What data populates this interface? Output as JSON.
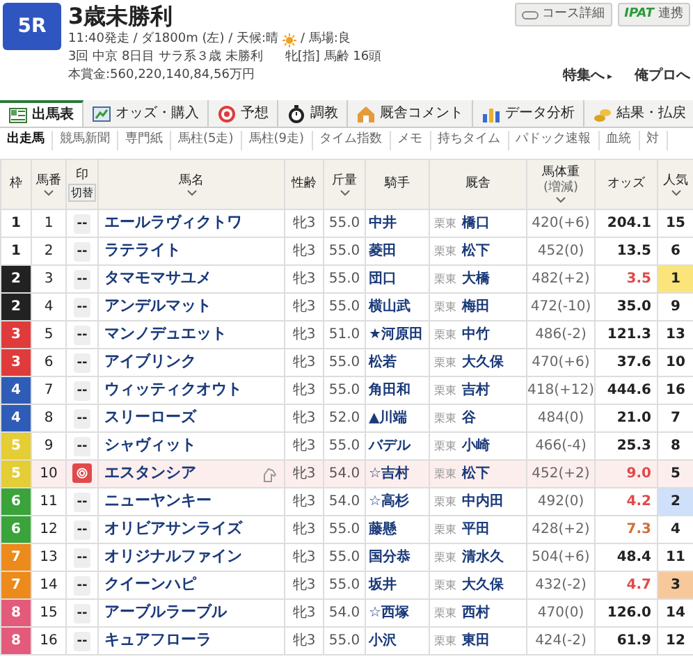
{
  "race": {
    "number": "5R",
    "title": "3歳未勝利",
    "info_before_icon": "11:40発走 / ダ1800m (左) / 天候:晴",
    "info_after_icon": "/ 馬場:良",
    "meta": "3回 中京 8日目 サラ系３歳 未勝利",
    "conditions": "牝[指] 馬齢 16頭",
    "prize": "本賞金:560,220,140,84,56万円"
  },
  "header_buttons": [
    {
      "label": "コース詳細",
      "kind": "course"
    },
    {
      "label": "連携",
      "kind": "ipat",
      "logo": "IPAT"
    }
  ],
  "links": [
    {
      "label": "特集へ",
      "arrow": "▸"
    },
    {
      "label": "俺プロへ"
    }
  ],
  "tabs": [
    {
      "label": "出馬表",
      "selected": true
    },
    {
      "label": "オッズ・購入",
      "selected": false
    },
    {
      "label": "予想",
      "selected": false
    },
    {
      "label": "調教",
      "selected": false
    },
    {
      "label": "厩舎コメント",
      "selected": false
    },
    {
      "label": "データ分析",
      "selected": false
    },
    {
      "label": "結果・払戻",
      "selected": false
    }
  ],
  "subtabs": [
    {
      "label": "出走馬",
      "selected": true
    },
    {
      "label": "競馬新聞",
      "selected": false
    },
    {
      "label": "専門紙",
      "selected": false
    },
    {
      "label": "馬柱(5走)",
      "selected": false
    },
    {
      "label": "馬柱(9走)",
      "selected": false
    },
    {
      "label": "タイム指数",
      "selected": false
    },
    {
      "label": "メモ",
      "selected": false
    },
    {
      "label": "持ちタイム",
      "selected": false
    },
    {
      "label": "パドック速報",
      "selected": false
    },
    {
      "label": "血統",
      "selected": false
    },
    {
      "label": "対",
      "selected": false
    }
  ],
  "table": {
    "columns": [
      {
        "label": "枠",
        "sortable": false
      },
      {
        "label": "馬番",
        "sortable": true
      },
      {
        "label": "印",
        "sortable": false,
        "button": "切替"
      },
      {
        "label": "馬名",
        "sortable": true
      },
      {
        "label": "性齢",
        "sortable": false
      },
      {
        "label": "斤量",
        "sortable": true
      },
      {
        "label": "騎手",
        "sortable": false
      },
      {
        "label": "厩舎",
        "sortable": false
      },
      {
        "label": "馬体重",
        "sublabel": "(増減)",
        "sortable": true
      },
      {
        "label": "オッズ",
        "sortable": false
      },
      {
        "label": "人気",
        "sortable": true
      }
    ],
    "rows": [
      {
        "frame": {
          "label": "1",
          "color": "#ffffff"
        },
        "number": "1",
        "mark": {
          "kind": "none",
          "label": "--"
        },
        "name": "エールラヴィクトワ",
        "icon": false,
        "selected": false,
        "sex_age": "牝3",
        "weight": "55.0",
        "jockey": "中井",
        "region": "栗東",
        "trainer": "橋口",
        "body_weight": "420(+6)",
        "odds": {
          "value": "204.1"
        },
        "popularity": {
          "value": "15"
        }
      },
      {
        "frame": {
          "label": "1",
          "color": "#ffffff"
        },
        "number": "2",
        "mark": {
          "kind": "none",
          "label": "--"
        },
        "name": "ラテライト",
        "icon": false,
        "selected": false,
        "sex_age": "牝3",
        "weight": "55.0",
        "jockey": "菱田",
        "region": "栗東",
        "trainer": "松下",
        "body_weight": "452(0)",
        "odds": {
          "value": "13.5"
        },
        "popularity": {
          "value": "6"
        }
      },
      {
        "frame": {
          "label": "2",
          "color": "#222222"
        },
        "number": "3",
        "mark": {
          "kind": "none",
          "label": "--"
        },
        "name": "タマモマサユメ",
        "icon": false,
        "selected": false,
        "sex_age": "牝3",
        "weight": "55.0",
        "jockey": "団口",
        "region": "栗東",
        "trainer": "大橋",
        "body_weight": "482(+2)",
        "odds": {
          "value": "3.5",
          "color": "#e04a4a"
        },
        "popularity": {
          "value": "1",
          "color": "#fbe57a"
        }
      },
      {
        "frame": {
          "label": "2",
          "color": "#222222"
        },
        "number": "4",
        "mark": {
          "kind": "none",
          "label": "--"
        },
        "name": "アンデルマット",
        "icon": false,
        "selected": false,
        "sex_age": "牝3",
        "weight": "55.0",
        "jockey": "横山武",
        "region": "栗東",
        "trainer": "梅田",
        "body_weight": "472(-10)",
        "odds": {
          "value": "35.0"
        },
        "popularity": {
          "value": "9"
        }
      },
      {
        "frame": {
          "label": "3",
          "color": "#e03b3b"
        },
        "number": "5",
        "mark": {
          "kind": "none",
          "label": "--"
        },
        "name": "マンノデュエット",
        "icon": false,
        "selected": false,
        "sex_age": "牝3",
        "weight": "51.0",
        "jockey": "★河原田",
        "region": "栗東",
        "trainer": "中竹",
        "body_weight": "486(-2)",
        "odds": {
          "value": "121.3"
        },
        "popularity": {
          "value": "13"
        }
      },
      {
        "frame": {
          "label": "3",
          "color": "#e03b3b"
        },
        "number": "6",
        "mark": {
          "kind": "none",
          "label": "--"
        },
        "name": "アイブリンク",
        "icon": false,
        "selected": false,
        "sex_age": "牝3",
        "weight": "55.0",
        "jockey": "松若",
        "region": "栗東",
        "trainer": "大久保",
        "body_weight": "470(+6)",
        "odds": {
          "value": "37.6"
        },
        "popularity": {
          "value": "10"
        }
      },
      {
        "frame": {
          "label": "4",
          "color": "#2f5cb6"
        },
        "number": "7",
        "mark": {
          "kind": "none",
          "label": "--"
        },
        "name": "ウィッティクオウト",
        "icon": false,
        "selected": false,
        "sex_age": "牝3",
        "weight": "55.0",
        "jockey": "角田和",
        "region": "栗東",
        "trainer": "吉村",
        "body_weight": "418(+12)",
        "odds": {
          "value": "444.6"
        },
        "popularity": {
          "value": "16"
        }
      },
      {
        "frame": {
          "label": "4",
          "color": "#2f5cb6"
        },
        "number": "8",
        "mark": {
          "kind": "none",
          "label": "--"
        },
        "name": "スリーローズ",
        "icon": false,
        "selected": false,
        "sex_age": "牝3",
        "weight": "52.0",
        "jockey": "▲川端",
        "region": "栗東",
        "trainer": "谷",
        "body_weight": "484(0)",
        "odds": {
          "value": "21.0"
        },
        "popularity": {
          "value": "7"
        }
      },
      {
        "frame": {
          "label": "5",
          "color": "#e5cd35"
        },
        "number": "9",
        "mark": {
          "kind": "none",
          "label": "--"
        },
        "name": "シャヴィット",
        "icon": false,
        "selected": false,
        "sex_age": "牝3",
        "weight": "55.0",
        "jockey": "バデル",
        "region": "栗東",
        "trainer": "小崎",
        "body_weight": "466(-4)",
        "odds": {
          "value": "25.3"
        },
        "popularity": {
          "value": "8"
        }
      },
      {
        "frame": {
          "label": "5",
          "color": "#e5cd35"
        },
        "number": "10",
        "mark": {
          "kind": "circle"
        },
        "name": "エスタンシア",
        "icon": true,
        "selected": true,
        "sex_age": "牝3",
        "weight": "54.0",
        "jockey": "☆吉村",
        "region": "栗東",
        "trainer": "松下",
        "body_weight": "452(+2)",
        "odds": {
          "value": "9.0",
          "color": "#e04a4a"
        },
        "popularity": {
          "value": "5"
        }
      },
      {
        "frame": {
          "label": "6",
          "color": "#3aa33a"
        },
        "number": "11",
        "mark": {
          "kind": "none",
          "label": "--"
        },
        "name": "ニューヤンキー",
        "icon": false,
        "selected": false,
        "sex_age": "牝3",
        "weight": "54.0",
        "jockey": "☆高杉",
        "region": "栗東",
        "trainer": "中内田",
        "body_weight": "492(0)",
        "odds": {
          "value": "4.2",
          "color": "#e04a4a"
        },
        "popularity": {
          "value": "2",
          "color": "#cfe0fa"
        }
      },
      {
        "frame": {
          "label": "6",
          "color": "#3aa33a"
        },
        "number": "12",
        "mark": {
          "kind": "none",
          "label": "--"
        },
        "name": "オリビアサンライズ",
        "icon": false,
        "selected": false,
        "sex_age": "牝3",
        "weight": "55.0",
        "jockey": "藤懸",
        "region": "栗東",
        "trainer": "平田",
        "body_weight": "428(+2)",
        "odds": {
          "value": "7.3",
          "color": "#d0703a"
        },
        "popularity": {
          "value": "4"
        }
      },
      {
        "frame": {
          "label": "7",
          "color": "#ec8a1c"
        },
        "number": "13",
        "mark": {
          "kind": "none",
          "label": "--"
        },
        "name": "オリジナルファイン",
        "icon": false,
        "selected": false,
        "sex_age": "牝3",
        "weight": "55.0",
        "jockey": "国分恭",
        "region": "栗東",
        "trainer": "清水久",
        "body_weight": "504(+6)",
        "odds": {
          "value": "48.4"
        },
        "popularity": {
          "value": "11"
        }
      },
      {
        "frame": {
          "label": "7",
          "color": "#ec8a1c"
        },
        "number": "14",
        "mark": {
          "kind": "none",
          "label": "--"
        },
        "name": "クイーンハピ",
        "icon": false,
        "selected": false,
        "sex_age": "牝3",
        "weight": "55.0",
        "jockey": "坂井",
        "region": "栗東",
        "trainer": "大久保",
        "body_weight": "432(-2)",
        "odds": {
          "value": "4.7",
          "color": "#e04a4a"
        },
        "popularity": {
          "value": "3",
          "color": "#f7c99a"
        }
      },
      {
        "frame": {
          "label": "8",
          "color": "#e45a7a"
        },
        "number": "15",
        "mark": {
          "kind": "none",
          "label": "--"
        },
        "name": "アーブルラーブル",
        "icon": false,
        "selected": false,
        "sex_age": "牝3",
        "weight": "54.0",
        "jockey": "☆西塚",
        "region": "栗東",
        "trainer": "西村",
        "body_weight": "470(0)",
        "odds": {
          "value": "126.0"
        },
        "popularity": {
          "value": "14"
        }
      },
      {
        "frame": {
          "label": "8",
          "color": "#e45a7a"
        },
        "number": "16",
        "mark": {
          "kind": "none",
          "label": "--"
        },
        "name": "キュアフローラ",
        "icon": false,
        "selected": false,
        "sex_age": "牝3",
        "weight": "55.0",
        "jockey": "小沢",
        "region": "栗東",
        "trainer": "東田",
        "body_weight": "424(-2)",
        "odds": {
          "value": "61.9"
        },
        "popularity": {
          "value": "12"
        }
      }
    ]
  }
}
